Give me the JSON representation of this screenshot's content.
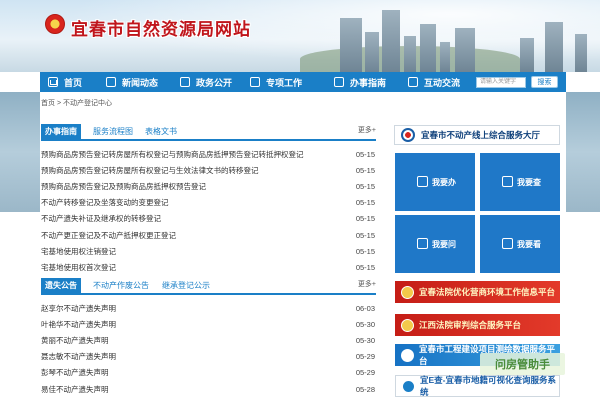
{
  "header": {
    "site_title": "宜春市自然资源局网站"
  },
  "nav": {
    "items": [
      {
        "label": "首页",
        "icon": "home-icon"
      },
      {
        "label": "新闻动态",
        "icon": "news-icon"
      },
      {
        "label": "政务公开",
        "icon": "gov-icon"
      },
      {
        "label": "专项工作",
        "icon": "edit-icon"
      },
      {
        "label": "办事指南",
        "icon": "guide-icon"
      },
      {
        "label": "互动交流",
        "icon": "chat-icon"
      }
    ],
    "search_placeholder": "请输入关键字",
    "search_button": "搜索"
  },
  "breadcrumb": "首页 > 不动产登记中心",
  "guide": {
    "tabs": [
      "办事指南",
      "服务流程图",
      "表格文书"
    ],
    "more": "更多+",
    "rows": [
      {
        "title": "预购商品房预告登记转房屋所有权登记与预购商品房抵押预告登记转抵押权登记",
        "date": "05-15"
      },
      {
        "title": "预购商品房预告登记转房屋所有权登记与生效法律文书的转移登记",
        "date": "05-15"
      },
      {
        "title": "预购商品房预告登记及预购商品房抵押权预告登记",
        "date": "05-15"
      },
      {
        "title": "不动产转移登记及坐落变动的变更登记",
        "date": "05-15"
      },
      {
        "title": "不动产遗失补证及继承权的转移登记",
        "date": "05-15"
      },
      {
        "title": "不动产更正登记及不动产抵押权更正登记",
        "date": "05-15"
      },
      {
        "title": "宅基地使用权注销登记",
        "date": "05-15"
      },
      {
        "title": "宅基地使用权首次登记",
        "date": "05-15"
      }
    ]
  },
  "notice": {
    "tabs": [
      "遗失公告",
      "不动产作废公告",
      "继承登记公示"
    ],
    "more": "更多+",
    "rows": [
      {
        "title": "赵享尔不动产遗失声明",
        "date": "06-03"
      },
      {
        "title": "叶艳华不动产遗失声明",
        "date": "05-30"
      },
      {
        "title": "黄丽不动产遗失声明",
        "date": "05-30"
      },
      {
        "title": "聂志敏不动产遗失声明",
        "date": "05-29"
      },
      {
        "title": "彭琴不动产遗失声明",
        "date": "05-29"
      },
      {
        "title": "易佳不动产遗失声明",
        "date": "05-28"
      }
    ]
  },
  "right": {
    "hall_title": "宜春市不动产线上综合服务大厅",
    "services": [
      "我要办",
      "我要查",
      "我要问",
      "我要看"
    ],
    "ads": [
      "宜春法院优化营商环境工作信息平台",
      "江西法院审判综合服务平台",
      "宜春市工程建设项目测绘数据服务平台",
      "宜E查-宜春市地籍可视化查询服务系统"
    ],
    "watermark": "问房管助手"
  }
}
